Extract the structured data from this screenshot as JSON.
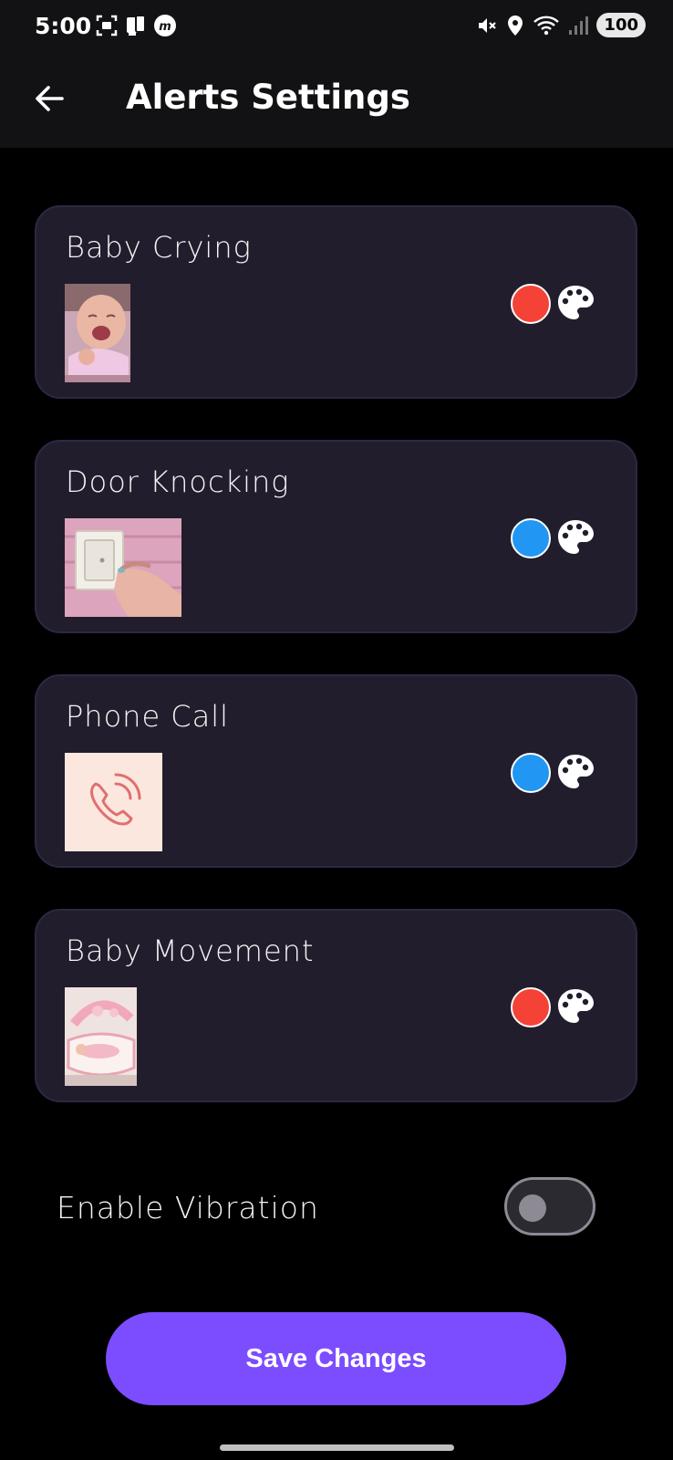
{
  "status_bar": {
    "time": "5:00",
    "battery": "100",
    "icons_left": [
      "screenshot-icon",
      "sim-icon",
      "app-icon"
    ],
    "icons_right": [
      "mute-icon",
      "location-icon",
      "wifi-icon",
      "signal-icon"
    ]
  },
  "app_bar": {
    "back_icon": "back-arrow-icon",
    "title": "Alerts Settings"
  },
  "alerts": [
    {
      "title": "Baby Crying",
      "image": "crying-baby-photo",
      "color": "#f44336",
      "palette_icon": "palette-icon"
    },
    {
      "title": "Door Knocking",
      "image": "doorbell-photo",
      "color": "#2196f3",
      "palette_icon": "palette-icon"
    },
    {
      "title": "Phone Call",
      "image": "phone-call-icon",
      "color": "#2196f3",
      "palette_icon": "palette-icon"
    },
    {
      "title": "Baby Movement",
      "image": "baby-bassinet-photo",
      "color": "#f44336",
      "palette_icon": "palette-icon"
    }
  ],
  "vibration": {
    "label": "Enable Vibration",
    "enabled": false
  },
  "save_button": {
    "label": "Save Changes"
  },
  "colors": {
    "accent": "#7c4dff",
    "card_bg": "#221d2c",
    "app_bar_bg": "#121214",
    "background": "#000000"
  }
}
